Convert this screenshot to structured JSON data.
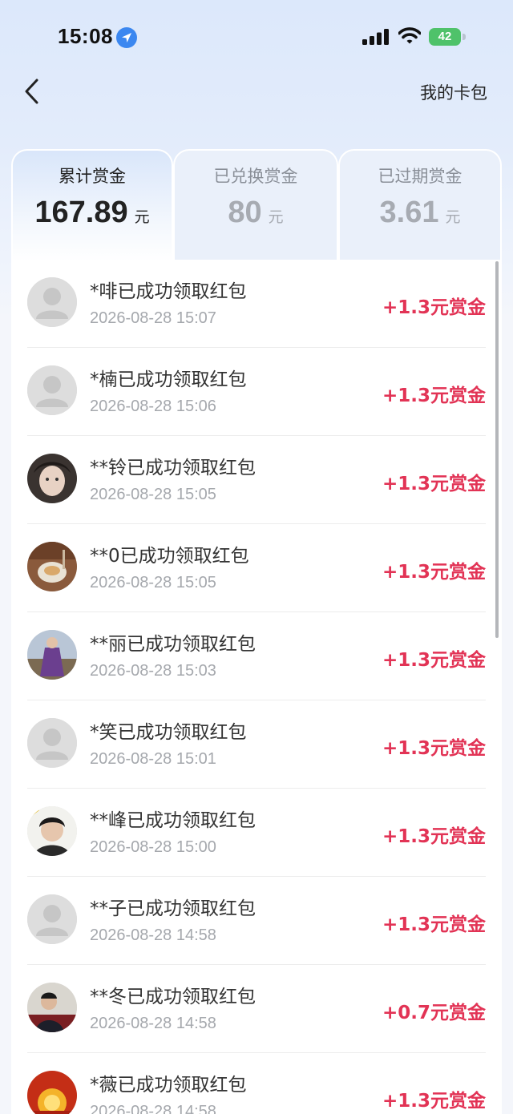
{
  "status": {
    "time": "15:08",
    "battery": "42"
  },
  "header": {
    "wallet_link": "我的卡包"
  },
  "tabs": [
    {
      "title": "累计赏金",
      "value": "167.89",
      "unit": "元",
      "active": true
    },
    {
      "title": "已兑换赏金",
      "value": "80",
      "unit": "元",
      "active": false
    },
    {
      "title": "已过期赏金",
      "value": "3.61",
      "unit": "元",
      "active": false
    }
  ],
  "records": [
    {
      "title": "*啡已成功领取红包",
      "time": "2026-08-28 15:07",
      "amount": "+1.3元赏金",
      "avatar": "default-avatar-icon"
    },
    {
      "title": "*楠已成功领取红包",
      "time": "2026-08-28 15:06",
      "amount": "+1.3元赏金",
      "avatar": "default-avatar-icon"
    },
    {
      "title": "**铃已成功领取红包",
      "time": "2026-08-28 15:05",
      "amount": "+1.3元赏金",
      "avatar": "user-photo-avatar"
    },
    {
      "title": "**0已成功领取红包",
      "time": "2026-08-28 15:05",
      "amount": "+1.3元赏金",
      "avatar": "food-photo-avatar"
    },
    {
      "title": "**丽已成功领取红包",
      "time": "2026-08-28 15:03",
      "amount": "+1.3元赏金",
      "avatar": "user-photo-avatar"
    },
    {
      "title": "*笑已成功领取红包",
      "time": "2026-08-28 15:01",
      "amount": "+1.3元赏金",
      "avatar": "default-avatar-icon"
    },
    {
      "title": "**峰已成功领取红包",
      "time": "2026-08-28 15:00",
      "amount": "+1.3元赏金",
      "avatar": "user-photo-avatar"
    },
    {
      "title": "**子已成功领取红包",
      "time": "2026-08-28 14:58",
      "amount": "+1.3元赏金",
      "avatar": "default-avatar-icon"
    },
    {
      "title": "**冬已成功领取红包",
      "time": "2026-08-28 14:58",
      "amount": "+0.7元赏金",
      "avatar": "user-photo-avatar"
    },
    {
      "title": "*薇已成功领取红包",
      "time": "2026-08-28 14:58",
      "amount": "+1.3元赏金",
      "avatar": "sunrise-photo-avatar"
    }
  ],
  "colors": {
    "amount": "#e23355",
    "background_top": "#dce8fb",
    "tab_inactive": "#eaf0fa"
  }
}
